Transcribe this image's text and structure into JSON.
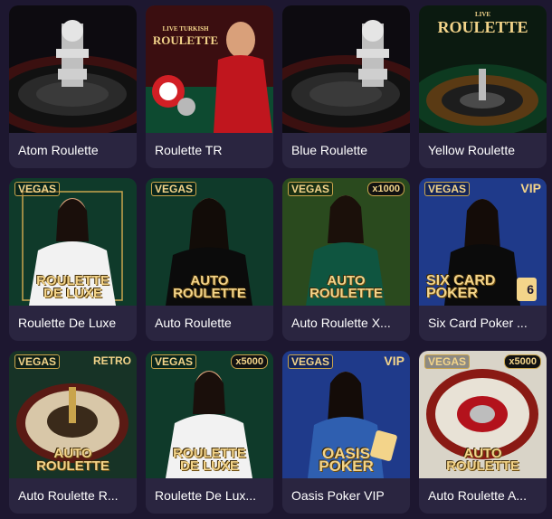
{
  "games": [
    {
      "title": "Atom Roulette"
    },
    {
      "title": "Roulette TR",
      "thumb_text": [
        "LIVE TURKISH",
        "ROULETTE"
      ]
    },
    {
      "title": "Blue Roulette"
    },
    {
      "title": "Yellow Roulette",
      "thumb_text": [
        "LIVE",
        "ROULETTE"
      ]
    },
    {
      "title": "Roulette De Luxe",
      "brand": "VEGAS",
      "thumb_text": [
        "ROULETTE",
        "DE LUXE"
      ]
    },
    {
      "title": "Auto Roulette",
      "brand": "VEGAS",
      "thumb_text": [
        "AUTO",
        "ROULETTE"
      ]
    },
    {
      "title": "Auto Roulette X...",
      "brand": "VEGAS",
      "tag": "x1000",
      "thumb_text": [
        "AUTO",
        "ROULETTE"
      ]
    },
    {
      "title": "Six Card Poker ...",
      "brand": "VEGAS",
      "tag": "VIP",
      "thumb_text": [
        "SIX CARD",
        "POKER"
      ],
      "badge": "6"
    },
    {
      "title": "Auto Roulette R...",
      "brand": "VEGAS",
      "tag": "RETRO",
      "thumb_text": [
        "AUTO",
        "ROULETTE"
      ]
    },
    {
      "title": "Roulette De Lux...",
      "brand": "VEGAS",
      "tag": "x5000",
      "thumb_text": [
        "ROULETTE",
        "DE LUXE"
      ]
    },
    {
      "title": "Oasis Poker VIP",
      "brand": "VEGAS",
      "tag": "VIP",
      "thumb_text": [
        "OASIS",
        "POKER"
      ]
    },
    {
      "title": "Auto Roulette A...",
      "brand": "VEGAS",
      "tag": "x5000",
      "thumb_text": [
        "AUTO",
        "ROULETTE"
      ]
    }
  ],
  "colors": {
    "page_bg": "#1d1730",
    "card_bg": "#2a2540",
    "gold": "#f3d48a",
    "vegas_green": "#0f3a2a",
    "vegas_blue": "#1f3a8a",
    "wheel_red": "#b3121c"
  }
}
